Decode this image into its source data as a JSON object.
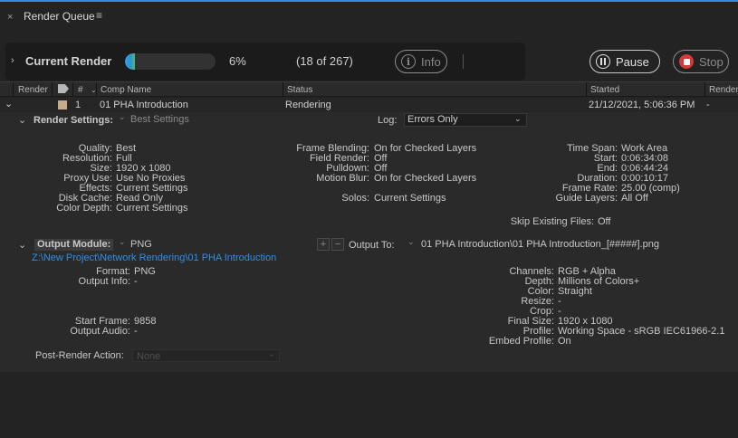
{
  "panel": {
    "close_glyph": "×",
    "title": "Render Queue",
    "menu_glyph": "≡",
    "accent_color": "#2d8ceb"
  },
  "status": {
    "expand_glyph": "›",
    "label": "Current Render",
    "progress_fraction": 0.11,
    "percent_text": "6%",
    "count_text": "(18 of 267)",
    "info_button": "Info",
    "info_glyph": "i",
    "pause_button": "Pause",
    "stop_button": "Stop"
  },
  "columns": {
    "render": "Render",
    "number": "#",
    "comp_name": "Comp Name",
    "status": "Status",
    "started": "Started",
    "render_time": "Render T"
  },
  "item": {
    "expand_glyph": "⌄",
    "label_color": "#c7ab88",
    "index": "1",
    "comp_name": "01 PHA Introduction",
    "status": "Rendering",
    "started": "21/12/2021, 5:06:36 PM",
    "render_time": "-"
  },
  "render_settings": {
    "section_label": "Render Settings:",
    "preset": "Best Settings",
    "log_label": "Log:",
    "log_value": "Errors Only",
    "left": [
      {
        "k": "Quality:",
        "v": "Best"
      },
      {
        "k": "Resolution:",
        "v": "Full"
      },
      {
        "k": "Size:",
        "v": "1920 x 1080"
      },
      {
        "k": "Proxy Use:",
        "v": "Use No Proxies"
      },
      {
        "k": "Effects:",
        "v": "Current Settings"
      },
      {
        "k": "Disk Cache:",
        "v": "Read Only"
      },
      {
        "k": "Color Depth:",
        "v": "Current Settings"
      }
    ],
    "middle": [
      {
        "k": "Frame Blending:",
        "v": "On for Checked Layers"
      },
      {
        "k": "Field Render:",
        "v": "Off"
      },
      {
        "k": "Pulldown:",
        "v": "Off"
      },
      {
        "k": "Motion Blur:",
        "v": "On for Checked Layers"
      },
      {
        "k": "Solos:",
        "v": "Current Settings"
      }
    ],
    "right": [
      {
        "k": "Time Span:",
        "v": "Work Area"
      },
      {
        "k": "Start:",
        "v": "0:06:34:08"
      },
      {
        "k": "End:",
        "v": "0:06:44:24"
      },
      {
        "k": "Duration:",
        "v": "0:00:10:17"
      },
      {
        "k": "Frame Rate:",
        "v": "25.00 (comp)"
      },
      {
        "k": "Guide Layers:",
        "v": "All Off"
      }
    ],
    "skip_existing": {
      "k": "Skip Existing Files:",
      "v": "Off"
    }
  },
  "output_module": {
    "section_label": "Output Module:",
    "preset": "PNG",
    "output_to_label": "Output To:",
    "output_to_value": "01 PHA Introduction\\01 PHA Introduction_[#####].png",
    "path": "Z:\\New Project\\Network Rendering\\01 PHA Introduction",
    "left_top": [
      {
        "k": "Format:",
        "v": "PNG"
      },
      {
        "k": "Output Info:",
        "v": "-"
      }
    ],
    "left_bottom": [
      {
        "k": "Start Frame:",
        "v": "9858"
      },
      {
        "k": "Output Audio:",
        "v": "-"
      }
    ],
    "right": [
      {
        "k": "Channels:",
        "v": "RGB + Alpha"
      },
      {
        "k": "Depth:",
        "v": "Millions of Colors+"
      },
      {
        "k": "Color:",
        "v": "Straight"
      },
      {
        "k": "Resize:",
        "v": "-"
      },
      {
        "k": "Crop:",
        "v": "-"
      },
      {
        "k": "Final Size:",
        "v": "1920 x 1080"
      },
      {
        "k": "Profile:",
        "v": "Working Space - sRGB IEC61966-2.1"
      },
      {
        "k": "Embed Profile:",
        "v": "On"
      }
    ]
  },
  "post_render": {
    "label": "Post-Render Action:",
    "value": "None"
  }
}
